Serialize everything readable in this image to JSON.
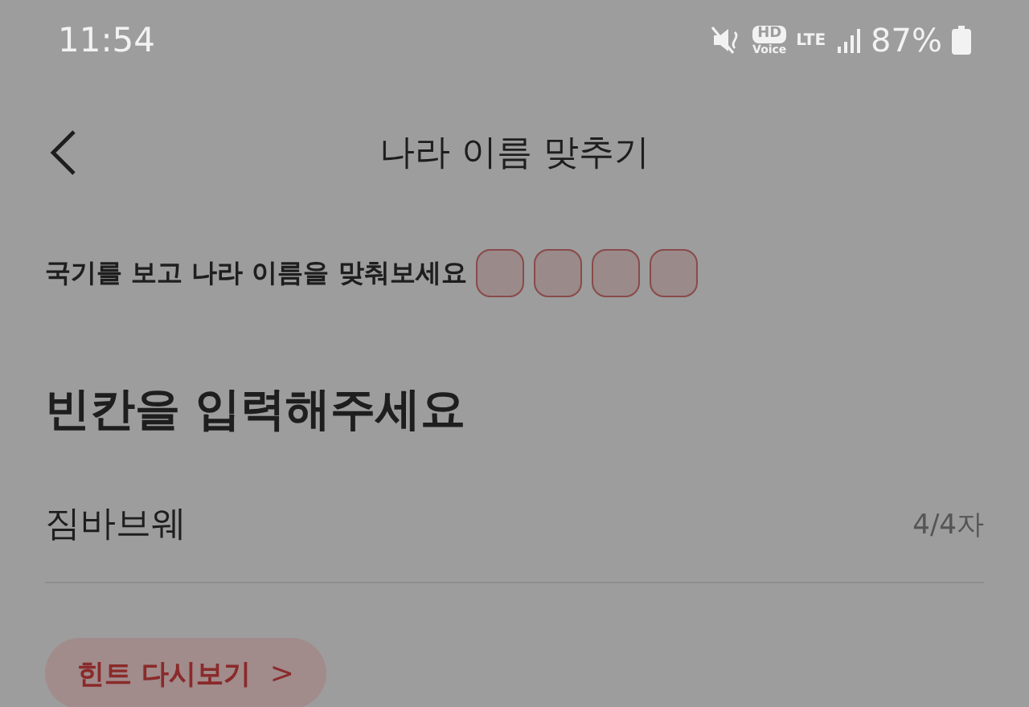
{
  "status_bar": {
    "time": "11:54",
    "battery": "87%",
    "network": "LTE",
    "voice": "HD",
    "voice_label": "Voice"
  },
  "header": {
    "title": "나라 이름 맞추기"
  },
  "prompt": {
    "text": "국기를 보고 나라 이름을 맞춰보세요",
    "slots": [
      {
        "filled": false
      },
      {
        "filled": false
      },
      {
        "filled": false
      },
      {
        "filled": false
      }
    ]
  },
  "heading": "빈칸을 입력해주세요",
  "answer": {
    "value": "짐바브웨",
    "count": "4/4자"
  },
  "hint_button": {
    "label": "힌트 다시보기",
    "chevron": ">"
  }
}
